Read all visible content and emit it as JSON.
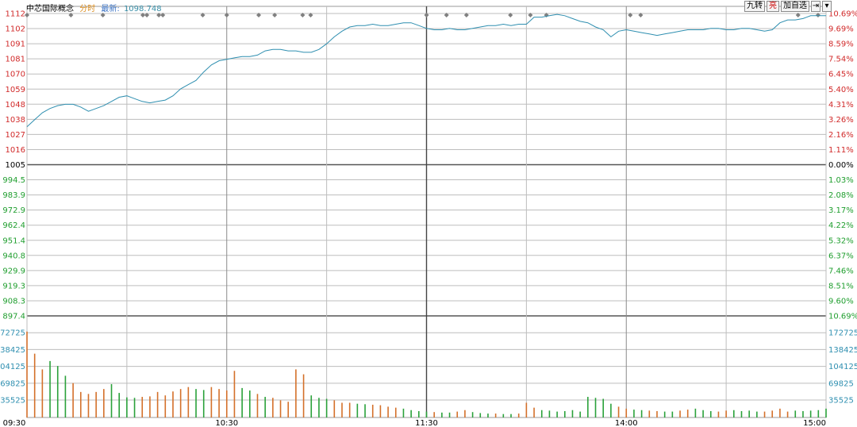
{
  "header": {
    "index_name": "中芯国际概念",
    "mode": "分时",
    "latest_label": "最新:",
    "latest_value": "1098.748"
  },
  "toolbar": {
    "nine_label": "九转",
    "bright_label": "亮",
    "add_watch_label": "加自选",
    "expand_label": "⇥",
    "menu_label": "▾"
  },
  "colors": {
    "price_line": "#2f8fb0",
    "up": "#d12a2a",
    "down": "#1f9e2e",
    "neutral": "#000000",
    "volume_up": "#d4702a",
    "volume_down": "#2aa13a",
    "volume_axis": "#2f8fb0",
    "grid": "#bdbdbd",
    "marker": "#808080"
  },
  "chart_data": {
    "type": "line",
    "title": "中芯国际概念 分时",
    "base_price": 1005,
    "price_ticks": [
      "1112",
      "1102",
      "1091",
      "1081",
      "1070",
      "1059",
      "1048",
      "1038",
      "1027",
      "1016",
      "1005",
      "994.5",
      "983.9",
      "972.9",
      "962.4",
      "951.4",
      "940.8",
      "929.9",
      "919.3",
      "908.3",
      "897.4"
    ],
    "pct_ticks": [
      "10.69%",
      "9.69%",
      "8.59%",
      "7.54%",
      "6.45%",
      "5.40%",
      "4.31%",
      "3.26%",
      "2.16%",
      "1.11%",
      "0.00%",
      "1.03%",
      "2.08%",
      "3.17%",
      "4.22%",
      "5.32%",
      "6.37%",
      "7.46%",
      "8.51%",
      "9.60%",
      "10.69%"
    ],
    "ylim": [
      897.4,
      1112.6
    ],
    "volume_ticks": [
      "172725",
      "138425",
      "104125",
      "69825",
      "35525"
    ],
    "volume_ylim": [
      0,
      207000
    ],
    "x_ticks": [
      "09:30",
      "10:30",
      "11:30",
      "14:00",
      "15:00"
    ],
    "price": [
      1032,
      1037,
      1042,
      1045,
      1047,
      1048,
      1048,
      1046,
      1043,
      1045,
      1047,
      1050,
      1053,
      1054,
      1052,
      1050,
      1049,
      1050,
      1051,
      1054,
      1059,
      1062,
      1065,
      1071,
      1076,
      1079,
      1080,
      1081,
      1082,
      1082,
      1083,
      1086,
      1087,
      1087,
      1086,
      1086,
      1085,
      1085,
      1087,
      1091,
      1096,
      1100,
      1103,
      1104,
      1104,
      1105,
      1104,
      1104,
      1105,
      1106,
      1106,
      1104,
      1102,
      1101,
      1101,
      1102,
      1101,
      1101,
      1102,
      1103,
      1104,
      1104,
      1105,
      1104,
      1105,
      1105,
      1110,
      1110,
      1111,
      1112,
      1111,
      1109,
      1107,
      1106,
      1103,
      1101,
      1096,
      1100,
      1101,
      1100,
      1099,
      1098,
      1097,
      1098,
      1099,
      1100,
      1101,
      1101,
      1101,
      1102,
      1102,
      1101,
      1101,
      1102,
      1102,
      1101,
      1100,
      1101,
      1106,
      1108,
      1108,
      1109,
      1111,
      1111,
      1111
    ],
    "volume": [
      175000,
      130000,
      98000,
      115000,
      105000,
      85000,
      70000,
      52000,
      48000,
      52000,
      58000,
      68000,
      50000,
      41000,
      40000,
      42000,
      43000,
      52000,
      45000,
      53000,
      58000,
      62000,
      58000,
      56000,
      62000,
      58000,
      55000,
      95000,
      60000,
      55000,
      48000,
      42000,
      40000,
      35000,
      32000,
      98000,
      88000,
      45000,
      40000,
      38000,
      35000,
      30000,
      30000,
      28000,
      27000,
      26000,
      25000,
      22000,
      20000,
      18000,
      15000,
      13000,
      12000,
      11000,
      10000,
      10000,
      12000,
      15000,
      11000,
      9000,
      8000,
      8000,
      7000,
      7000,
      8000,
      30000,
      20000,
      15000,
      14000,
      12000,
      13000,
      15000,
      12000,
      42000,
      40000,
      38000,
      28000,
      22000,
      18000,
      16000,
      15000,
      14000,
      13000,
      12000,
      12000,
      14000,
      16000,
      18000,
      15000,
      13000,
      12000,
      14000,
      15000,
      13000,
      14000,
      12000,
      12000,
      14000,
      18000,
      12000,
      14000,
      13000,
      14000,
      15000,
      18000
    ],
    "volume_up_flags": [
      1,
      1,
      1,
      0,
      0,
      0,
      1,
      1,
      1,
      1,
      1,
      0,
      0,
      0,
      0,
      1,
      1,
      1,
      1,
      1,
      1,
      1,
      0,
      0,
      1,
      1,
      1,
      1,
      0,
      0,
      1,
      0,
      1,
      1,
      1,
      1,
      1,
      0,
      0,
      0,
      1,
      1,
      1,
      0,
      0,
      1,
      1,
      1,
      1,
      0,
      0,
      0,
      0,
      1,
      0,
      0,
      1,
      1,
      0,
      0,
      0,
      1,
      0,
      0,
      1,
      1,
      1,
      0,
      0,
      0,
      0,
      0,
      0,
      0,
      0,
      0,
      0,
      1,
      1,
      0,
      0,
      1,
      1,
      0,
      0,
      1,
      1,
      0,
      0,
      0,
      1,
      1,
      0,
      0,
      0,
      0,
      1,
      1,
      1,
      1,
      0,
      0,
      0,
      0,
      0
    ]
  }
}
